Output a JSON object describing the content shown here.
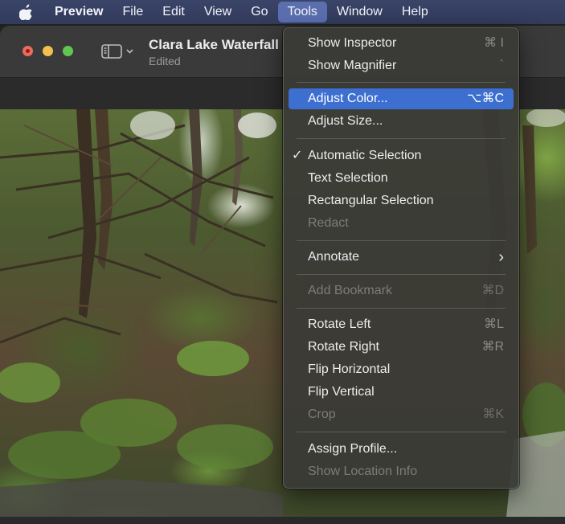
{
  "menubar": {
    "app": "Preview",
    "items": [
      "File",
      "Edit",
      "View",
      "Go",
      "Tools",
      "Window",
      "Help"
    ]
  },
  "window": {
    "title": "Clara Lake Waterfall",
    "subtitle": "Edited"
  },
  "tools_menu": {
    "show_inspector": {
      "label": "Show Inspector",
      "shortcut": "⌘ I"
    },
    "show_magnifier": {
      "label": "Show Magnifier",
      "shortcut": "`"
    },
    "adjust_color": {
      "label": "Adjust Color...",
      "shortcut": "⌥⌘C"
    },
    "adjust_size": {
      "label": "Adjust Size..."
    },
    "automatic_selection": {
      "label": "Automatic Selection",
      "check": "✓"
    },
    "text_selection": {
      "label": "Text Selection"
    },
    "rectangular_selection": {
      "label": "Rectangular Selection"
    },
    "redact": {
      "label": "Redact"
    },
    "annotate": {
      "label": "Annotate",
      "arrow": "›"
    },
    "add_bookmark": {
      "label": "Add Bookmark",
      "shortcut": "⌘D"
    },
    "rotate_left": {
      "label": "Rotate Left",
      "shortcut": "⌘L"
    },
    "rotate_right": {
      "label": "Rotate Right",
      "shortcut": "⌘R"
    },
    "flip_horizontal": {
      "label": "Flip Horizontal"
    },
    "flip_vertical": {
      "label": "Flip Vertical"
    },
    "crop": {
      "label": "Crop",
      "shortcut": "⌘K"
    },
    "assign_profile": {
      "label": "Assign Profile..."
    },
    "show_location_info": {
      "label": "Show Location Info"
    }
  },
  "colors": {
    "highlight": "#3d6fd1",
    "menubar": "#353e60"
  },
  "icons": [
    "apple-icon",
    "sidebar-toggle-icon",
    "chevron-down-icon",
    "checkmark-icon",
    "chevron-right-icon"
  ]
}
